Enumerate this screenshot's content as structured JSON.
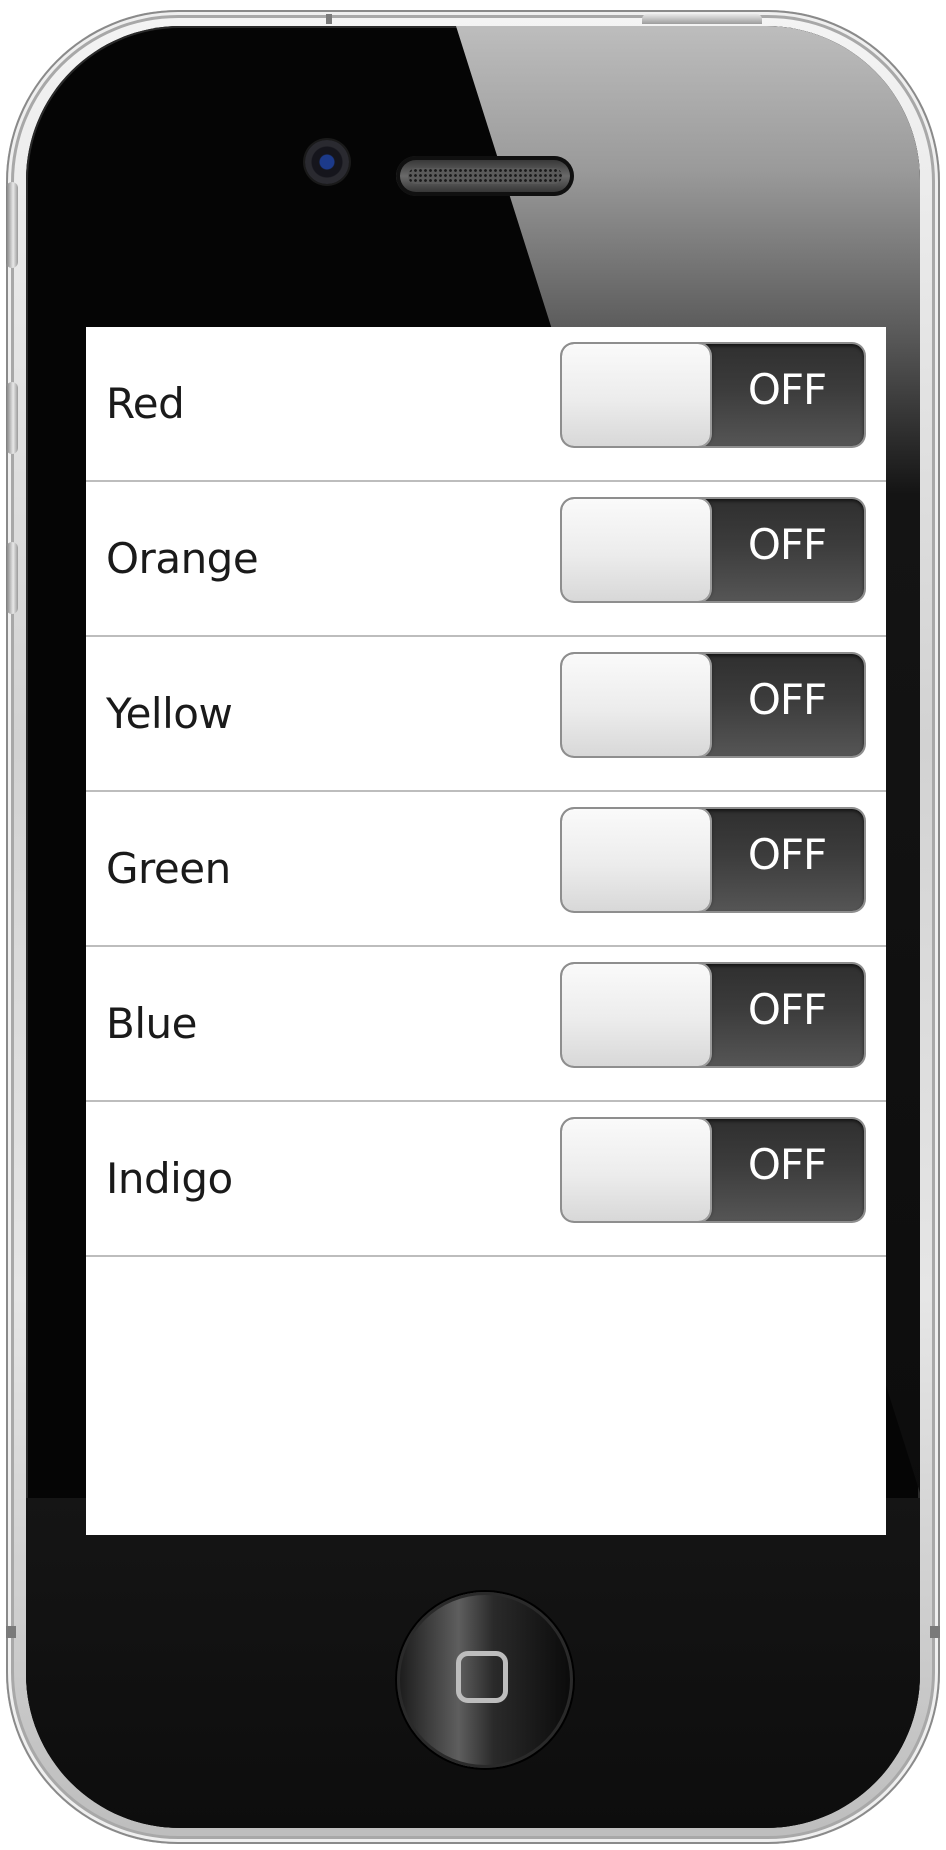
{
  "device": {
    "body_color": "#d2d2d2",
    "bezel_color": "#050505",
    "icons": [
      "camera-icon",
      "speaker-icon",
      "home-square-icon"
    ]
  },
  "settings": {
    "rows": [
      {
        "label": "Red",
        "toggle": "OFF"
      },
      {
        "label": "Orange",
        "toggle": "OFF"
      },
      {
        "label": "Yellow",
        "toggle": "OFF"
      },
      {
        "label": "Green",
        "toggle": "OFF"
      },
      {
        "label": "Blue",
        "toggle": "OFF"
      },
      {
        "label": "Indigo",
        "toggle": "OFF"
      }
    ]
  },
  "colors": {
    "toggle_off_track": "#3c3c3c",
    "toggle_knob": "#ececec",
    "separator": "#bdbdbd",
    "label_text": "#1a1a1a"
  }
}
